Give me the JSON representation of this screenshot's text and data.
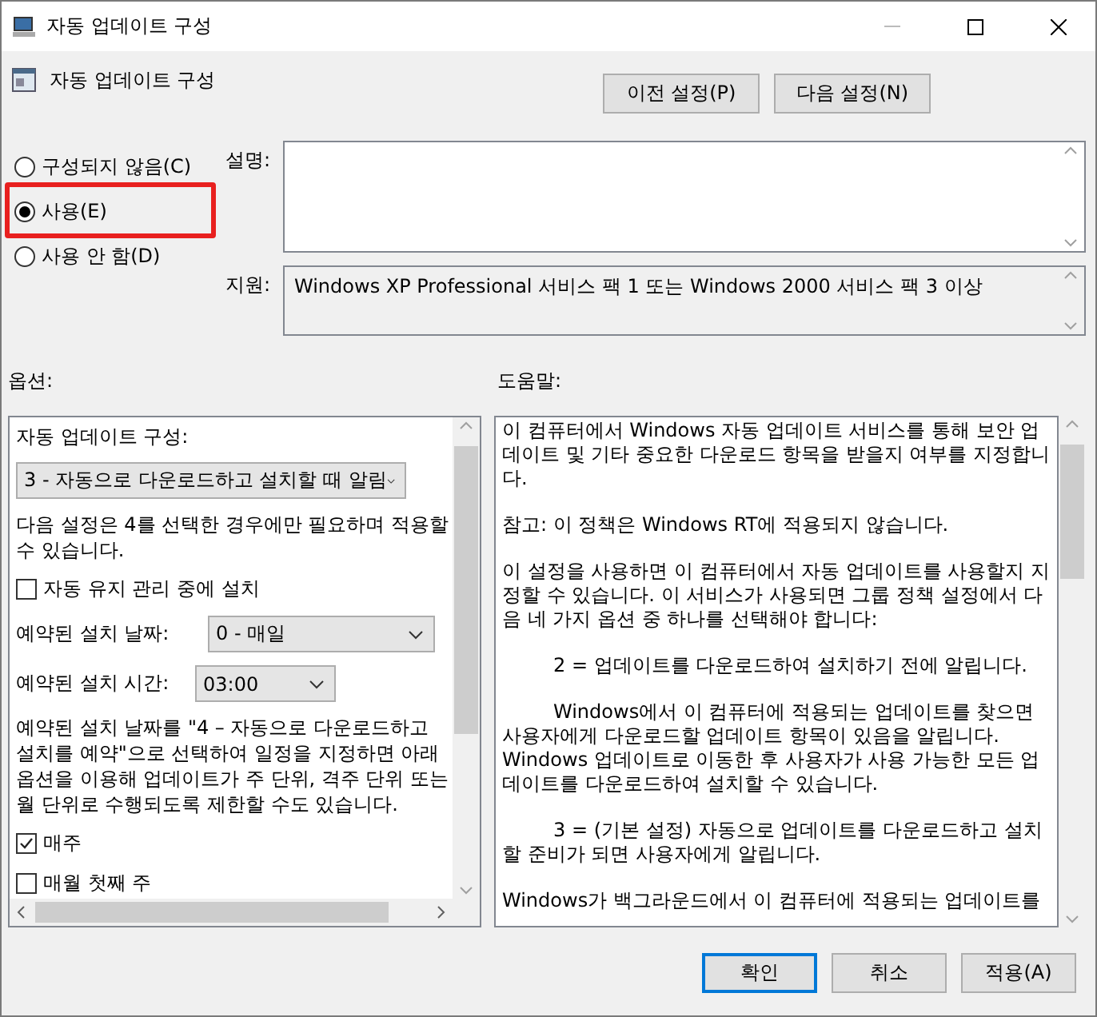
{
  "window": {
    "title": "자동 업데이트 구성"
  },
  "header": {
    "title": "자동 업데이트 구성",
    "buttons": [
      "이전 설정(P)",
      "다음 설정(N)"
    ]
  },
  "radios": [
    {
      "label": "구성되지 않음(C)",
      "selected": false,
      "highlighted": false
    },
    {
      "label": "사용(E)",
      "selected": true,
      "highlighted": true
    },
    {
      "label": "사용 안 함(D)",
      "selected": false,
      "highlighted": false
    }
  ],
  "comment": {
    "label": "설명:"
  },
  "supported": {
    "label": "지원:",
    "value": "Windows XP Professional 서비스 팩 1 또는 Windows 2000 서비스 팩 3 이상"
  },
  "options": {
    "label": "옵션:",
    "items": [
      {
        "kind": "label",
        "text": "자동 업데이트 구성:"
      },
      {
        "kind": "dropdown",
        "value": "3 - 자동으로 다운로드하고 설치할 때 알림"
      },
      {
        "kind": "text",
        "text": "다음 설정은 4를 선택한 경우에만 필요하며 적용할 수 있습니다."
      },
      {
        "kind": "checkbox",
        "text": "자동 유지 관리 중에 설치",
        "checked": false
      },
      {
        "kind": "labeled-dropdown",
        "text": "예약된 설치 날짜:",
        "value": "0 - 매일"
      },
      {
        "kind": "labeled-dropdown",
        "text": "예약된 설치 시간:",
        "value": "03:00"
      },
      {
        "kind": "text",
        "text": "예약된 설치 날짜를 \"4 – 자동으로 다운로드하고 설치를 예약\"으로 선택하여 일정을 지정하면 아래 옵션을 이용해 업데이트가 주 단위, 격주 단위 또는 월 단위로 수행되도록 제한할 수도 있습니다."
      },
      {
        "kind": "checkbox",
        "text": "매주",
        "checked": true
      },
      {
        "kind": "checkbox",
        "text": "매월 첫째 주",
        "checked": false
      }
    ]
  },
  "help": {
    "label": "도움말:",
    "paragraphs": [
      {
        "kind": "plain",
        "text": "이 컴퓨터에서 Windows 자동 업데이트 서비스를 통해 보안 업데이트 및 기타 중요한 다운로드 항목을 받을지 여부를 지정합니다."
      },
      {
        "kind": "plain",
        "text": "참고: 이 정책은 Windows RT에 적용되지 않습니다."
      },
      {
        "kind": "plain",
        "text": "이 설정을 사용하면 이 컴퓨터에서 자동 업데이트를 사용할지 지정할 수 있습니다. 이 서비스가 사용되면 그룹 정책 설정에서 다음 네 가지 옵션 중 하나를 선택해야 합니다:"
      },
      {
        "kind": "indented",
        "text": "2 = 업데이트를 다운로드하여 설치하기 전에 알립니다."
      },
      {
        "kind": "indented",
        "text": "Windows에서 이 컴퓨터에 적용되는 업데이트를 찾으면 사용자에게 다운로드할 업데이트 항목이 있음을 알립니다. Windows 업데이트로 이동한 후 사용자가 사용 가능한 모든 업데이트를 다운로드하여 설치할 수 있습니다."
      },
      {
        "kind": "indented",
        "text": "3 = (기본 설정) 자동으로 업데이트를 다운로드하고 설치할 준비가 되면 사용자에게 알립니다."
      },
      {
        "kind": "plain",
        "text": "Windows가 백그라운드에서 이 컴퓨터에 적용되는 업데이트를"
      }
    ]
  },
  "footer": {
    "buttons": [
      {
        "label": "확인",
        "default": true
      },
      {
        "label": "취소",
        "default": false
      },
      {
        "label": "적용(A)",
        "default": false
      }
    ]
  }
}
